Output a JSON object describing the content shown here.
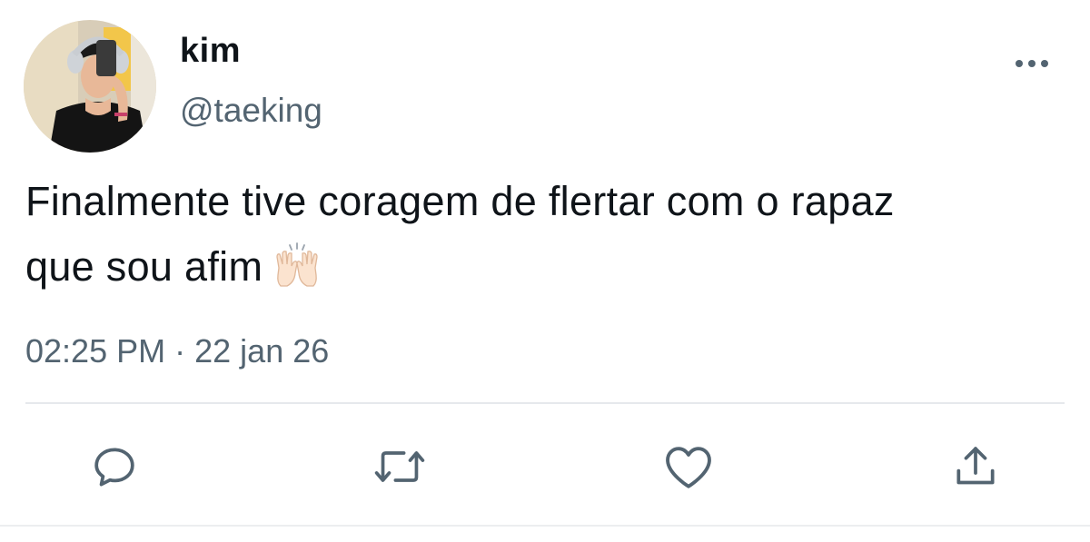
{
  "tweet": {
    "display_name": "kim",
    "handle": "@taeking",
    "text_line1": "Finalmente tive coragem de flertar com o rapaz",
    "text_line2": "que sou afim",
    "emoji": "🙌",
    "time": "02:25 PM",
    "separator": "·",
    "date": "22 jan 26"
  },
  "icons": {
    "more": "more-horizontal-icon",
    "reply": "reply-icon",
    "retweet": "retweet-icon",
    "like": "heart-icon",
    "share": "share-icon"
  },
  "colors": {
    "text": "#0f1419",
    "secondary": "#536471",
    "divider": "#e6e9ec"
  }
}
